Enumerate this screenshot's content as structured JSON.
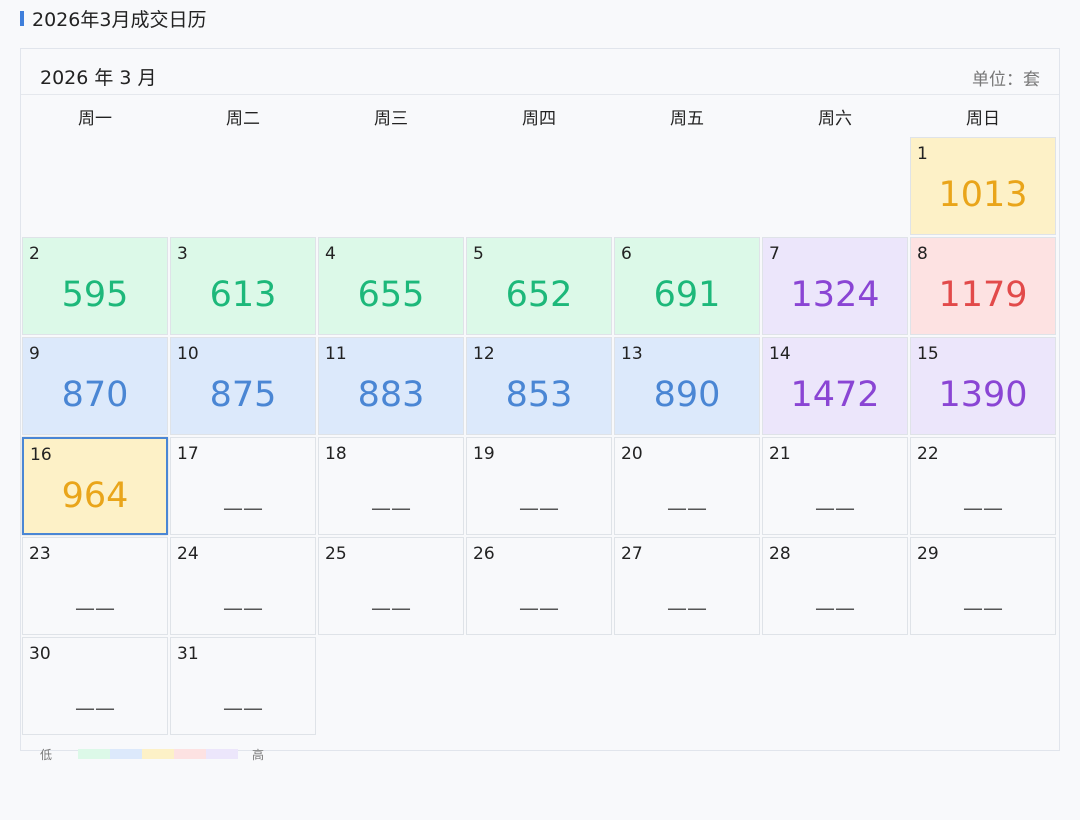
{
  "page": {
    "title": "2026年3月成交日历"
  },
  "calendar": {
    "month_title": "2026 年 3 月",
    "unit_label": "单位：套",
    "weekdays": [
      "周一",
      "周二",
      "周三",
      "周四",
      "周五",
      "周六",
      "周日"
    ],
    "leading_blanks": 6,
    "days": [
      {
        "day": "1",
        "value": "1013",
        "level": "mid"
      },
      {
        "day": "2",
        "value": "595",
        "level": "low"
      },
      {
        "day": "3",
        "value": "613",
        "level": "low"
      },
      {
        "day": "4",
        "value": "655",
        "level": "low"
      },
      {
        "day": "5",
        "value": "652",
        "level": "low"
      },
      {
        "day": "6",
        "value": "691",
        "level": "low"
      },
      {
        "day": "7",
        "value": "1324",
        "level": "top"
      },
      {
        "day": "8",
        "value": "1179",
        "level": "high"
      },
      {
        "day": "9",
        "value": "870",
        "level": "mid_low"
      },
      {
        "day": "10",
        "value": "875",
        "level": "mid_low"
      },
      {
        "day": "11",
        "value": "883",
        "level": "mid_low"
      },
      {
        "day": "12",
        "value": "853",
        "level": "mid_low"
      },
      {
        "day": "13",
        "value": "890",
        "level": "mid_low"
      },
      {
        "day": "14",
        "value": "1472",
        "level": "top"
      },
      {
        "day": "15",
        "value": "1390",
        "level": "top"
      },
      {
        "day": "16",
        "value": "964",
        "level": "mid",
        "selected": true
      },
      {
        "day": "17",
        "value": "——",
        "level": "none"
      },
      {
        "day": "18",
        "value": "——",
        "level": "none"
      },
      {
        "day": "19",
        "value": "——",
        "level": "none"
      },
      {
        "day": "20",
        "value": "——",
        "level": "none"
      },
      {
        "day": "21",
        "value": "——",
        "level": "none"
      },
      {
        "day": "22",
        "value": "——",
        "level": "none"
      },
      {
        "day": "23",
        "value": "——",
        "level": "none"
      },
      {
        "day": "24",
        "value": "——",
        "level": "none"
      },
      {
        "day": "25",
        "value": "——",
        "level": "none"
      },
      {
        "day": "26",
        "value": "——",
        "level": "none"
      },
      {
        "day": "27",
        "value": "——",
        "level": "none"
      },
      {
        "day": "28",
        "value": "——",
        "level": "none"
      },
      {
        "day": "29",
        "value": "——",
        "level": "none"
      },
      {
        "day": "30",
        "value": "——",
        "level": "none"
      },
      {
        "day": "31",
        "value": "——",
        "level": "none"
      }
    ]
  },
  "levels": {
    "low": {
      "bg": "#dcf9e8",
      "fg": "#1db87a"
    },
    "mid_low": {
      "bg": "#dce9fb",
      "fg": "#4a86d4"
    },
    "mid": {
      "bg": "#fdf1c7",
      "fg": "#e9a51a"
    },
    "high": {
      "bg": "#fde2e2",
      "fg": "#e24a4a"
    },
    "top": {
      "bg": "#ece6fb",
      "fg": "#8a45d4"
    },
    "none": {
      "bg": "#f8f9fb",
      "fg": "#555555"
    }
  },
  "legend": {
    "low_label": "低",
    "high_label": "高",
    "swatches": [
      "#dcf9e8",
      "#dce9fb",
      "#fdf1c7",
      "#fde2e2",
      "#ece6fb"
    ]
  }
}
